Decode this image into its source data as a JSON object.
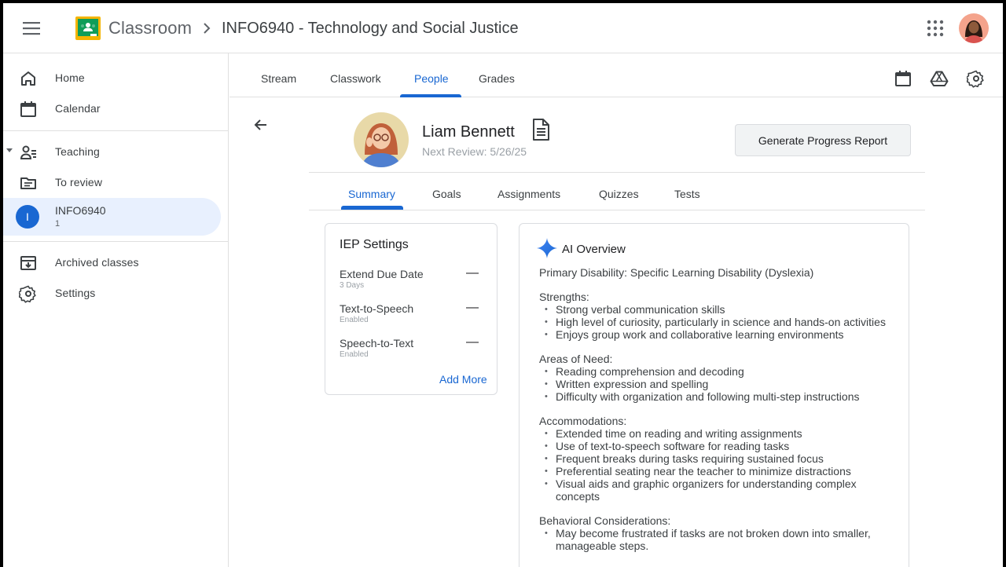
{
  "header": {
    "brand": "Classroom",
    "course_title": "INFO6940 - Technology and Social Justice"
  },
  "sidebar": {
    "home": "Home",
    "calendar": "Calendar",
    "teaching": "Teaching",
    "to_review": "To review",
    "course": {
      "initial": "I",
      "name": "INFO6940",
      "sub": "1"
    },
    "archived": "Archived classes",
    "settings": "Settings"
  },
  "tabs": {
    "stream": "Stream",
    "classwork": "Classwork",
    "people": "People",
    "grades": "Grades"
  },
  "student": {
    "name": "Liam Bennett",
    "next_review": "Next Review: 5/26/25",
    "report_button": "Generate Progress Report"
  },
  "subtabs": {
    "summary": "Summary",
    "goals": "Goals",
    "assignments": "Assignments",
    "quizzes": "Quizzes",
    "tests": "Tests"
  },
  "iep": {
    "title": "IEP Settings",
    "rows": [
      {
        "name": "Extend Due Date",
        "value": "3 Days"
      },
      {
        "name": "Text-to-Speech",
        "value": "Enabled"
      },
      {
        "name": "Speech-to-Text",
        "value": "Enabled"
      }
    ],
    "minus": "—",
    "add_more": "Add More"
  },
  "ai": {
    "title": "AI Overview",
    "primary": "Primary Disability: Specific Learning Disability (Dyslexia)",
    "strengths_title": "Strengths:",
    "strengths": [
      "Strong verbal communication skills",
      "High level of curiosity, particularly in science and hands-on activities",
      "Enjoys group work and collaborative learning environments"
    ],
    "needs_title": "Areas of Need:",
    "needs": [
      "Reading comprehension and decoding",
      "Written expression and spelling",
      "Difficulty with organization and following multi-step instructions"
    ],
    "accom_title": "Accommodations:",
    "accom": [
      "Extended time on reading and writing assignments",
      "Use of text-to-speech software for reading tasks",
      "Frequent breaks during tasks requiring sustained focus",
      "Preferential seating near the teacher to minimize distractions",
      "Visual aids and graphic organizers for understanding complex concepts"
    ],
    "behav_title": "Behavioral Considerations:",
    "behav": [
      "May become frustrated if tasks are not broken down into smaller, manageable steps."
    ]
  },
  "colors": {
    "accent": "#1967d2",
    "selected_bg": "#e8f0fe",
    "logo_green": "#0f9d58",
    "logo_yellow": "#f4b400"
  }
}
